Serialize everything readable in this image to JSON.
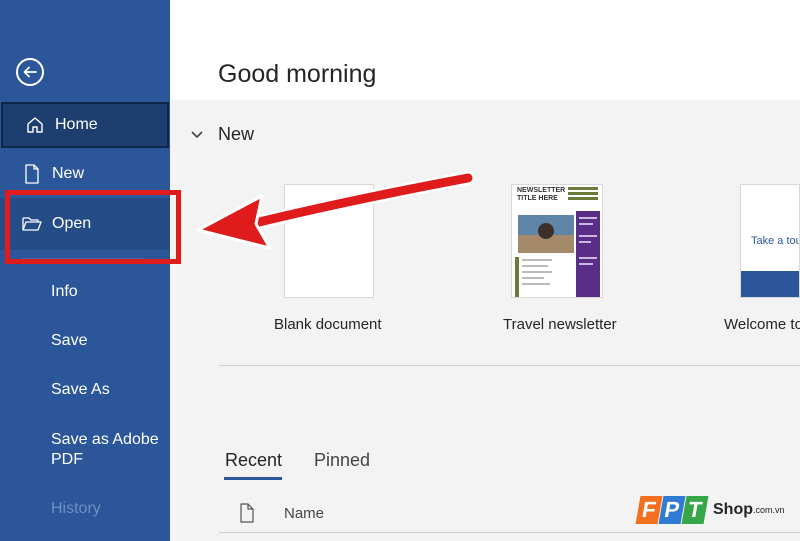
{
  "header": {
    "greeting": "Good morning"
  },
  "sidebar": {
    "back_icon": "back-arrow-icon",
    "items": [
      {
        "label": "Home",
        "icon": "home-icon",
        "selected": true
      },
      {
        "label": "New",
        "icon": "document-icon"
      },
      {
        "label": "Open",
        "icon": "folder-open-icon"
      },
      {
        "label": "Info"
      },
      {
        "label": "Save"
      },
      {
        "label": "Save As"
      },
      {
        "label": "Save as Adobe PDF"
      },
      {
        "label": "History",
        "disabled": true
      }
    ]
  },
  "new_section": {
    "title": "New",
    "templates": [
      {
        "label": "Blank document"
      },
      {
        "label": "Travel newsletter",
        "thumb_title_line1": "NEWSLETTER",
        "thumb_title_line2": "TITLE HERE"
      },
      {
        "label": "Welcome to",
        "thumb_text": "Take a tou"
      }
    ]
  },
  "files": {
    "tabs": [
      {
        "label": "Recent",
        "active": true
      },
      {
        "label": "Pinned"
      }
    ],
    "columns": [
      "Name"
    ]
  },
  "watermark": {
    "letters": [
      "F",
      "P",
      "T"
    ],
    "shop": "Shop",
    "domain": ".com.vn"
  },
  "colors": {
    "sidebar": "#2b579a",
    "highlight": "#e01b1b",
    "arrow": "#e01b1b"
  }
}
